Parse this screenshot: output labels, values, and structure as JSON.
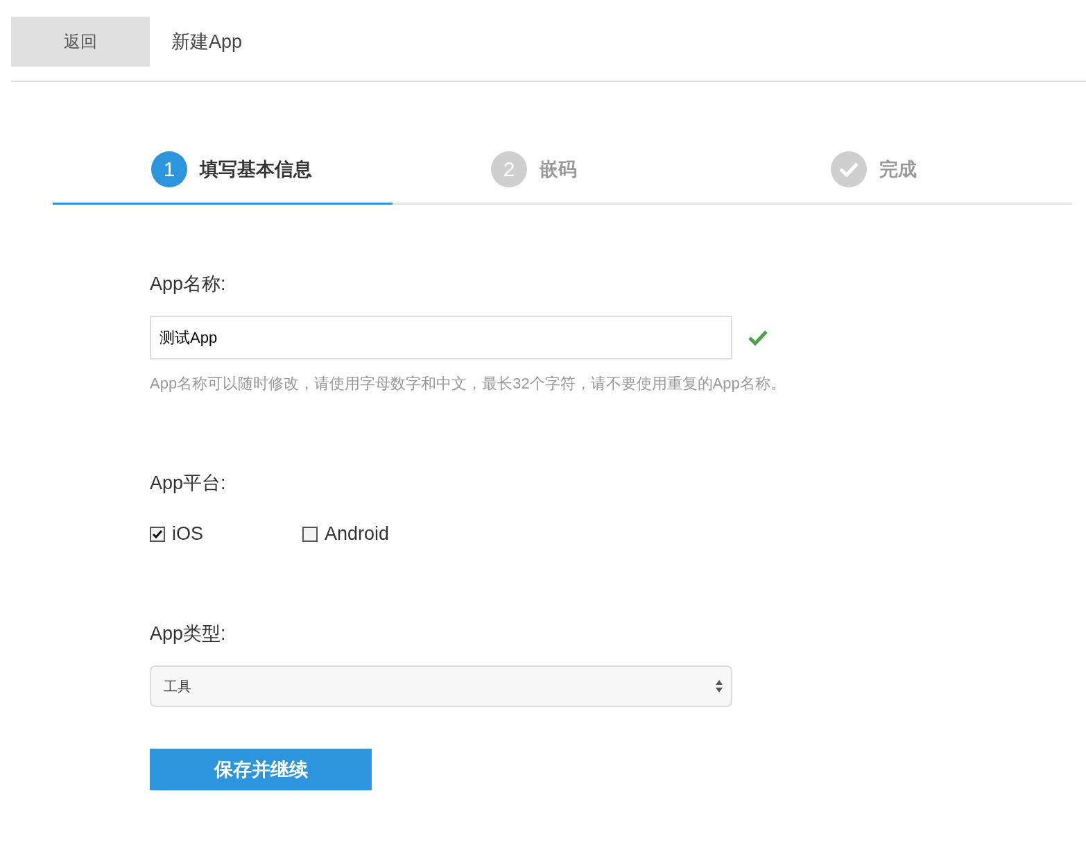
{
  "header": {
    "back_button": "返回",
    "title": "新建App"
  },
  "steps": [
    {
      "kind": "number",
      "marker": "1",
      "label": "填写基本信息",
      "selected": true
    },
    {
      "kind": "number",
      "marker": "2",
      "label": "嵌码",
      "selected": false
    },
    {
      "kind": "check",
      "label": "完成",
      "selected": false
    }
  ],
  "form": {
    "name_label": "App名称:",
    "name_value": "测试App",
    "name_valid": true,
    "name_hint": "App名称可以随时修改，请使用字母数字和中文，最长32个字符，请不要使用重复的App名称。",
    "platform_label": "App平台:",
    "platforms": [
      {
        "label": "iOS",
        "checked": true
      },
      {
        "label": "Android",
        "checked": false
      }
    ],
    "type_label": "App类型:",
    "type_value": "工具",
    "submit": "保存并继续"
  }
}
